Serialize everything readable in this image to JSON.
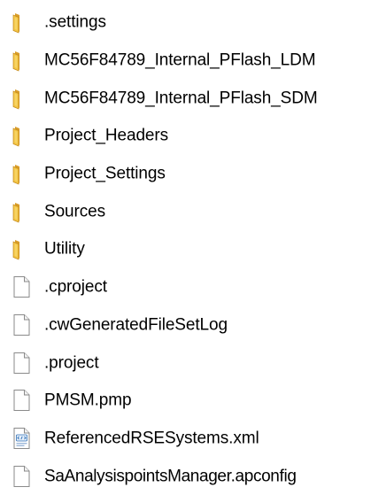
{
  "colors": {
    "folder_front": "#f3c544",
    "folder_back": "#d99d2a",
    "folder_shadow": "#c58a1c",
    "doc_border": "#8a8a8a",
    "doc_fill": "#ffffff",
    "xml_accent": "#2f6fb5"
  },
  "files": [
    {
      "name": ".settings",
      "icon": "folder-icon"
    },
    {
      "name": "MC56F84789_Internal_PFlash_LDM",
      "icon": "folder-icon"
    },
    {
      "name": "MC56F84789_Internal_PFlash_SDM",
      "icon": "folder-icon"
    },
    {
      "name": "Project_Headers",
      "icon": "folder-icon"
    },
    {
      "name": "Project_Settings",
      "icon": "folder-icon"
    },
    {
      "name": "Sources",
      "icon": "folder-icon"
    },
    {
      "name": "Utility",
      "icon": "folder-icon"
    },
    {
      "name": ".cproject",
      "icon": "file-icon"
    },
    {
      "name": ".cwGeneratedFileSetLog",
      "icon": "file-icon"
    },
    {
      "name": ".project",
      "icon": "file-icon"
    },
    {
      "name": "PMSM.pmp",
      "icon": "file-icon"
    },
    {
      "name": "ReferencedRSESystems.xml",
      "icon": "xml-file-icon"
    },
    {
      "name": "SaAnalysispointsManager.apconfig",
      "icon": "file-icon"
    }
  ]
}
